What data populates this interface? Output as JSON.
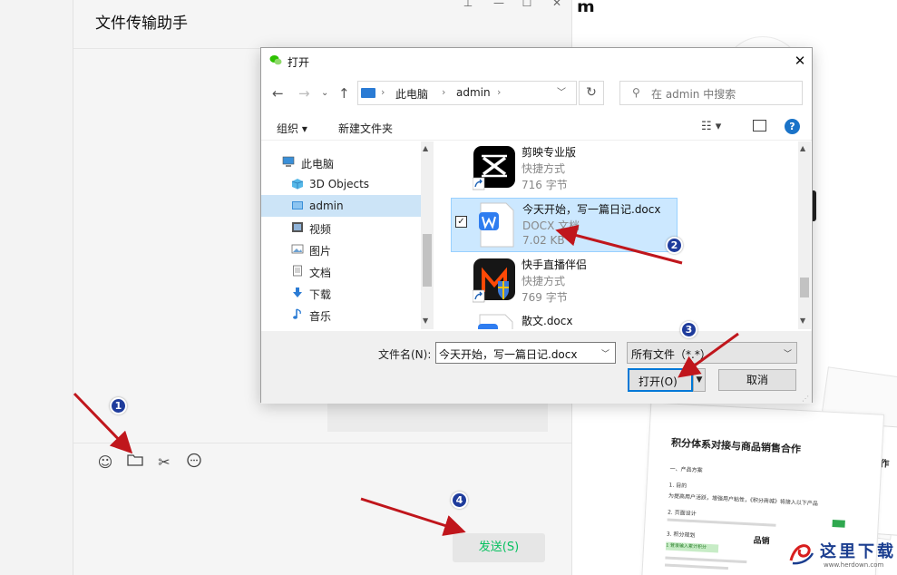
{
  "background": {
    "heading": "ₘ",
    "chat": {
      "title": "文件传输助手",
      "send_label": "发送(S)",
      "tools": [
        "emoji-icon",
        "folder-icon",
        "scissors-icon",
        "chat-history-icon"
      ]
    },
    "doc_preview": {
      "title": "积分体系对接与商品销售合作",
      "lines": [
        "一、产品方案",
        "1. 目的",
        "为提高用户活跃，增强用户粘性，《积分商城》将接入以下产品",
        "2. 页面设计",
        "3. 积分规划"
      ],
      "highlight": "1 登录输入累计积分",
      "side_text": "协作",
      "side_heading": "品销",
      "note_line": "1 登录输入累计积分"
    },
    "watermark": {
      "brand": "这里下载",
      "url": "www.herdown.com"
    }
  },
  "dialog": {
    "title": "打开",
    "breadcrumb": [
      "此电脑",
      "admin"
    ],
    "search_placeholder": "在 admin 中搜索",
    "toolbar": {
      "organize": "组织 ▾",
      "new_folder": "新建文件夹",
      "help": "?"
    },
    "nav_items": [
      {
        "label": "此电脑",
        "icon": "computer-icon"
      },
      {
        "label": "3D Objects",
        "icon": "3d-objects-icon"
      },
      {
        "label": "admin",
        "icon": "user-folder-icon",
        "selected": true
      },
      {
        "label": "视频",
        "icon": "video-folder-icon"
      },
      {
        "label": "图片",
        "icon": "picture-folder-icon"
      },
      {
        "label": "文档",
        "icon": "document-folder-icon"
      },
      {
        "label": "下载",
        "icon": "download-folder-icon"
      },
      {
        "label": "音乐",
        "icon": "music-folder-icon"
      }
    ],
    "files": [
      {
        "name": "剪映专业版",
        "type": "快捷方式",
        "size": "716 字节",
        "icon": "capcut-icon"
      },
      {
        "name": "今天开始，写一篇日记.docx",
        "type": "DOCX 文档",
        "size": "7.02 KB",
        "icon": "wps-doc-icon",
        "selected": true
      },
      {
        "name": "快手直播伴侣",
        "type": "快捷方式",
        "size": "769 字节",
        "icon": "kuaishou-icon"
      },
      {
        "name": "散文.docx",
        "icon": "wps-doc-icon"
      }
    ],
    "filename_label": "文件名(N):",
    "filename_value": "今天开始，写一篇日记.docx",
    "filetype_value": "所有文件（*.*）",
    "open_label": "打开(O)",
    "cancel_label": "取消"
  },
  "annotations": [
    {
      "number": "1",
      "color": "#1f3c9c"
    },
    {
      "number": "2",
      "color": "#1f3c9c"
    },
    {
      "number": "3",
      "color": "#1f3c9c"
    },
    {
      "number": "4",
      "color": "#1f3c9c"
    }
  ],
  "colors": {
    "arrow": "#c0161c",
    "send_text": "#07c160",
    "selection": "#cce8ff",
    "accent": "#0078d7"
  }
}
